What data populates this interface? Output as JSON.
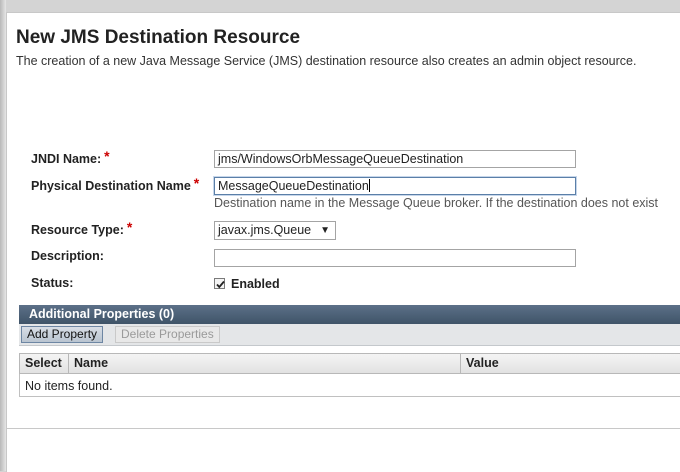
{
  "page": {
    "title": "New JMS Destination Resource",
    "description": "The creation of a new Java Message Service (JMS) destination resource also creates an admin object resource."
  },
  "form": {
    "jndi_label": "JNDI Name:",
    "jndi_value": "jms/WindowsOrbMessageQueueDestination",
    "physical_label": "Physical Destination Name",
    "physical_value": "MessageQueueDestination",
    "physical_hint": "Destination name in the Message Queue broker. If the destination does not exist",
    "resource_type_label": "Resource Type:",
    "resource_type_value": "javax.jms.Queue",
    "description_label": "Description:",
    "description_value": "",
    "status_label": "Status:",
    "status_enabled_label": "Enabled",
    "status_enabled": true,
    "required_marker": "*"
  },
  "properties": {
    "title": "Additional Properties (0)",
    "add_button": "Add Property",
    "delete_button": "Delete Properties",
    "columns": [
      "Select",
      "Name",
      "Value"
    ],
    "empty_text": "No items found."
  },
  "icons": {
    "dropdown": "chevron-down-icon",
    "checkbox": "checkmark-icon"
  },
  "colors": {
    "required": "#cc0000",
    "table_header": "#4a5f75"
  }
}
